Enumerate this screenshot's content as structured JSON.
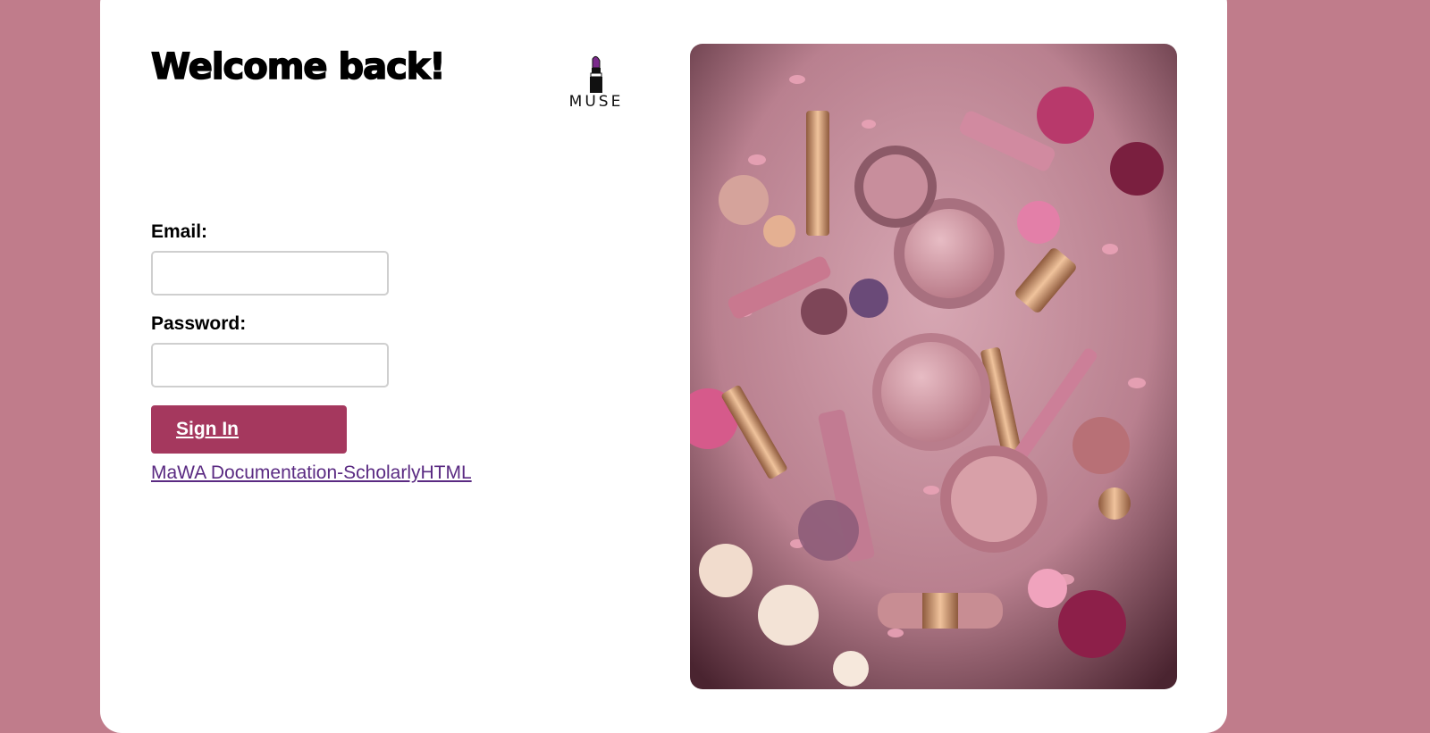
{
  "login": {
    "title": "Welcome back!",
    "logo_text": "MUSE",
    "email_label": "Email:",
    "email_value": "",
    "password_label": "Password:",
    "password_value": "",
    "signin_label": "Sign In",
    "doc_link": "MaWA Documentation-ScholarlyHTML"
  },
  "icons": {
    "logo": "lipstick-icon"
  },
  "colors": {
    "background": "#c07c8b",
    "card": "#ffffff",
    "button": "#a5385e",
    "link": "#5a2a82",
    "lipstick": "#7b2a8c"
  }
}
